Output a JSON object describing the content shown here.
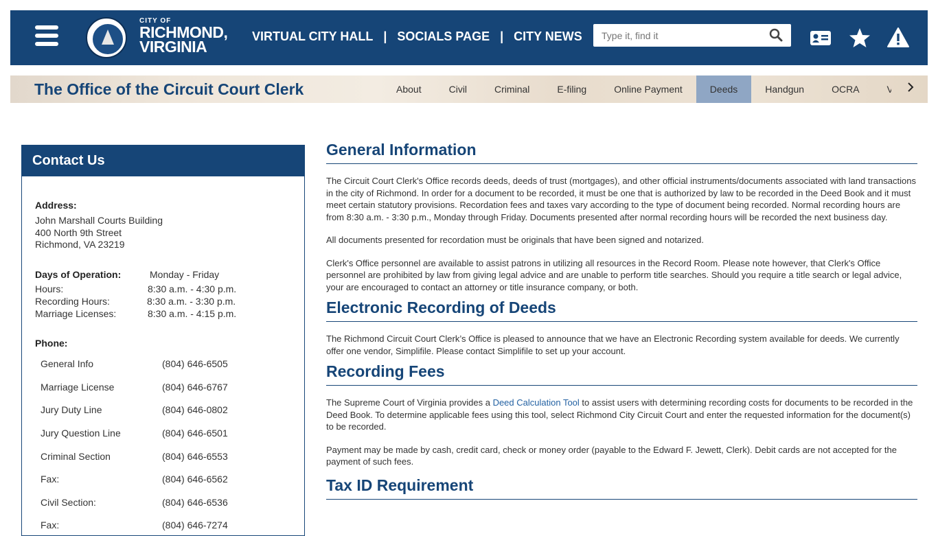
{
  "header": {
    "logo": {
      "small": "CITY OF",
      "line1": "RICHMOND,",
      "line2": "VIRGINIA"
    },
    "nav": [
      {
        "label": "VIRTUAL CITY HALL"
      },
      {
        "label": "SOCIALS PAGE"
      },
      {
        "label": "CITY NEWS"
      }
    ],
    "nav_separator": "|",
    "search": {
      "placeholder": "Type it, find it"
    },
    "icons": [
      "contact-card-icon",
      "star-icon",
      "alert-icon"
    ],
    "colors": {
      "primary": "#164577",
      "active_tab": "#8fa6c4",
      "link": "#2462a3"
    }
  },
  "subheader": {
    "title": "The Office of the Circuit Court Clerk",
    "tabs": [
      {
        "label": "About"
      },
      {
        "label": "Civil"
      },
      {
        "label": "Criminal"
      },
      {
        "label": "E-filing"
      },
      {
        "label": "Online Payment"
      },
      {
        "label": "Deeds"
      },
      {
        "label": "Handgun"
      },
      {
        "label": "OCRA"
      },
      {
        "label": "V"
      }
    ],
    "active_tab": "Deeds"
  },
  "contact": {
    "title": "Contact Us",
    "address_label": "Address:",
    "address": [
      "John Marshall Courts Building",
      "400 North 9th Street",
      "Richmond, VA 23219"
    ],
    "days_label": "Days of Operation:",
    "days_value": "Monday - Friday",
    "hours": [
      {
        "label": "Hours:",
        "value": "8:30 a.m. - 4:30 p.m."
      },
      {
        "label": "Recording Hours:",
        "value": "8:30 a.m. - 3:30 p.m."
      },
      {
        "label": "Marriage Licenses:",
        "value": "8:30 a.m. - 4:15 p.m."
      }
    ],
    "phone_label": "Phone:",
    "phones": [
      {
        "label": "General Info",
        "number": "(804) 646-6505"
      },
      {
        "label": "Marriage License",
        "number": "(804) 646-6767"
      },
      {
        "label": "Jury Duty Line",
        "number": "(804) 646-0802"
      },
      {
        "label": "Jury Question Line",
        "number": "(804) 646-6501"
      },
      {
        "label": "Criminal Section",
        "number": "(804) 646-6553"
      },
      {
        "label": "Fax:",
        "number": "(804) 646-6562"
      },
      {
        "label": "Civil Section:",
        "number": "(804) 646-6536"
      },
      {
        "label": "Fax:",
        "number": "(804) 646-7274"
      }
    ]
  },
  "main": {
    "general": {
      "heading": "General Information",
      "p1": "The Circuit Court Clerk's Office records deeds, deeds of trust (mortgages), and other official instruments/documents associated with land transactions in the city of Richmond. In order for a document to be recorded, it must be one that is authorized by law to be recorded in the Deed Book and it must meet certain statutory provisions. Recordation fees and taxes vary according to the type of document being recorded. Normal recording hours are from 8:30 a.m. - 3:30 p.m., Monday through Friday.  Documents presented after normal recording hours will be recorded the next business day.",
      "p2": "All documents presented for recordation must be originals that have been signed and notarized.",
      "p3": "Clerk's Office personnel are available to assist patrons in utilizing all resources in the Record Room.  Please note however, that Clerk's Office personnel are prohibited by law from giving legal advice and are unable to perform title searches.  Should you require a title search or legal advice, your are encouraged to contact an attorney or title insurance company, or both."
    },
    "electronic": {
      "heading": "Electronic Recording of Deeds",
      "p1": "The Richmond Circuit Court Clerk’s Office is pleased to announce that we have an Electronic Recording system available for deeds. We currently offer one vendor, Simplifile. Please contact Simplifile to set up your account."
    },
    "fees": {
      "heading": "Recording Fees",
      "p1_before": "The Supreme Court of Virginia provides a ",
      "p1_link": "Deed Calculation Tool",
      "p1_after": "  to assist users with determining recording costs for documents to be recorded in the Deed Book. To determine applicable fees using this tool, select Richmond City Circuit Court and enter the requested information for the document(s) to be recorded.",
      "p2": "Payment may be made by cash, credit card, check or money order (payable to the Edward F. Jewett, Clerk). Debit cards are not accepted for the payment of such fees."
    },
    "tax": {
      "heading": "Tax ID Requirement"
    }
  }
}
